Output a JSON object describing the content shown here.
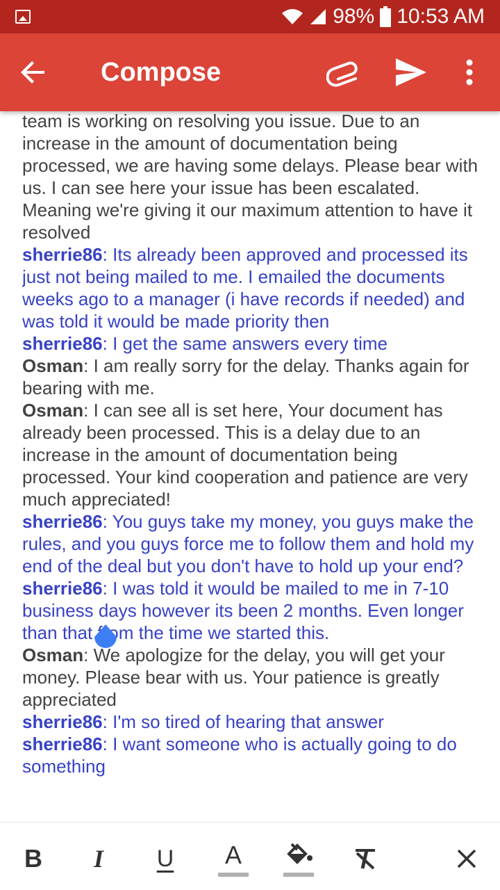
{
  "status_bar": {
    "battery": "98%",
    "time": "10:53 AM",
    "icons": [
      "image-notification-icon",
      "wifi-icon",
      "signal-icon",
      "battery-icon"
    ]
  },
  "app_bar": {
    "title": "Compose",
    "icons": [
      "back-arrow-icon",
      "attach-icon",
      "send-icon",
      "more-vert-icon"
    ],
    "color": "#db4437"
  },
  "messages": [
    {
      "speaker": "",
      "text": "team is working on resolving you issue. Due to an increase in the amount of documentation being processed, we are having some delays. Please bear with us. I can see here your issue has been escalated. Meaning we're giving it our maximum attention to have it resolved",
      "role": "agent"
    },
    {
      "speaker": "sherrie86",
      "text": ": Its already been approved and processed its just not being mailed to me. I emailed the documents weeks ago to a manager (i have records if needed) and was told it would be made priority then",
      "role": "cust"
    },
    {
      "speaker": "sherrie86",
      "text": ": I get the same answers every time",
      "role": "cust"
    },
    {
      "speaker": "Osman",
      "text": ": I am really sorry for the delay. Thanks again for bearing with me.",
      "role": "agent"
    },
    {
      "speaker": "Osman",
      "text": ": I can see all is set here, Your document has already been processed. This is a delay due to an increase in the amount of documentation being processed. Your kind cooperation and patience are very much appreciated!",
      "role": "agent"
    },
    {
      "speaker": "sherrie86",
      "text": ": You guys take my money, you guys make the rules, and you guys force me to follow them and hold my end of the deal but you don't have to hold up your end?",
      "role": "cust"
    },
    {
      "speaker": "sherrie86",
      "text": ": I was told it would be mailed to me in 7-10 business days however its been 2 months. Even longer than that from the time we started this.",
      "role": "cust"
    },
    {
      "speaker": "Osman",
      "text": ": We apologize for the delay, you will get your money. Please bear with us. Your patience is greatly appreciated",
      "role": "agent"
    },
    {
      "speaker": "sherrie86",
      "text": ": I'm so tired of hearing that answer",
      "role": "cust"
    },
    {
      "speaker": "sherrie86",
      "text": ": I want someone who is actually going to do something",
      "role": "cust"
    }
  ],
  "format_bar": {
    "buttons": [
      "bold-icon",
      "italic-icon",
      "underline-icon",
      "text-color-icon",
      "fill-color-icon",
      "clear-format-icon",
      "close-icon"
    ],
    "labels": {
      "bold": "B",
      "italic": "I",
      "underline": "U",
      "text_color": "A"
    }
  },
  "colors": {
    "status_bar": "#b3261e",
    "customer_text": "#3742c5",
    "agent_text": "#424242",
    "cursor": "#3d7ef5"
  }
}
